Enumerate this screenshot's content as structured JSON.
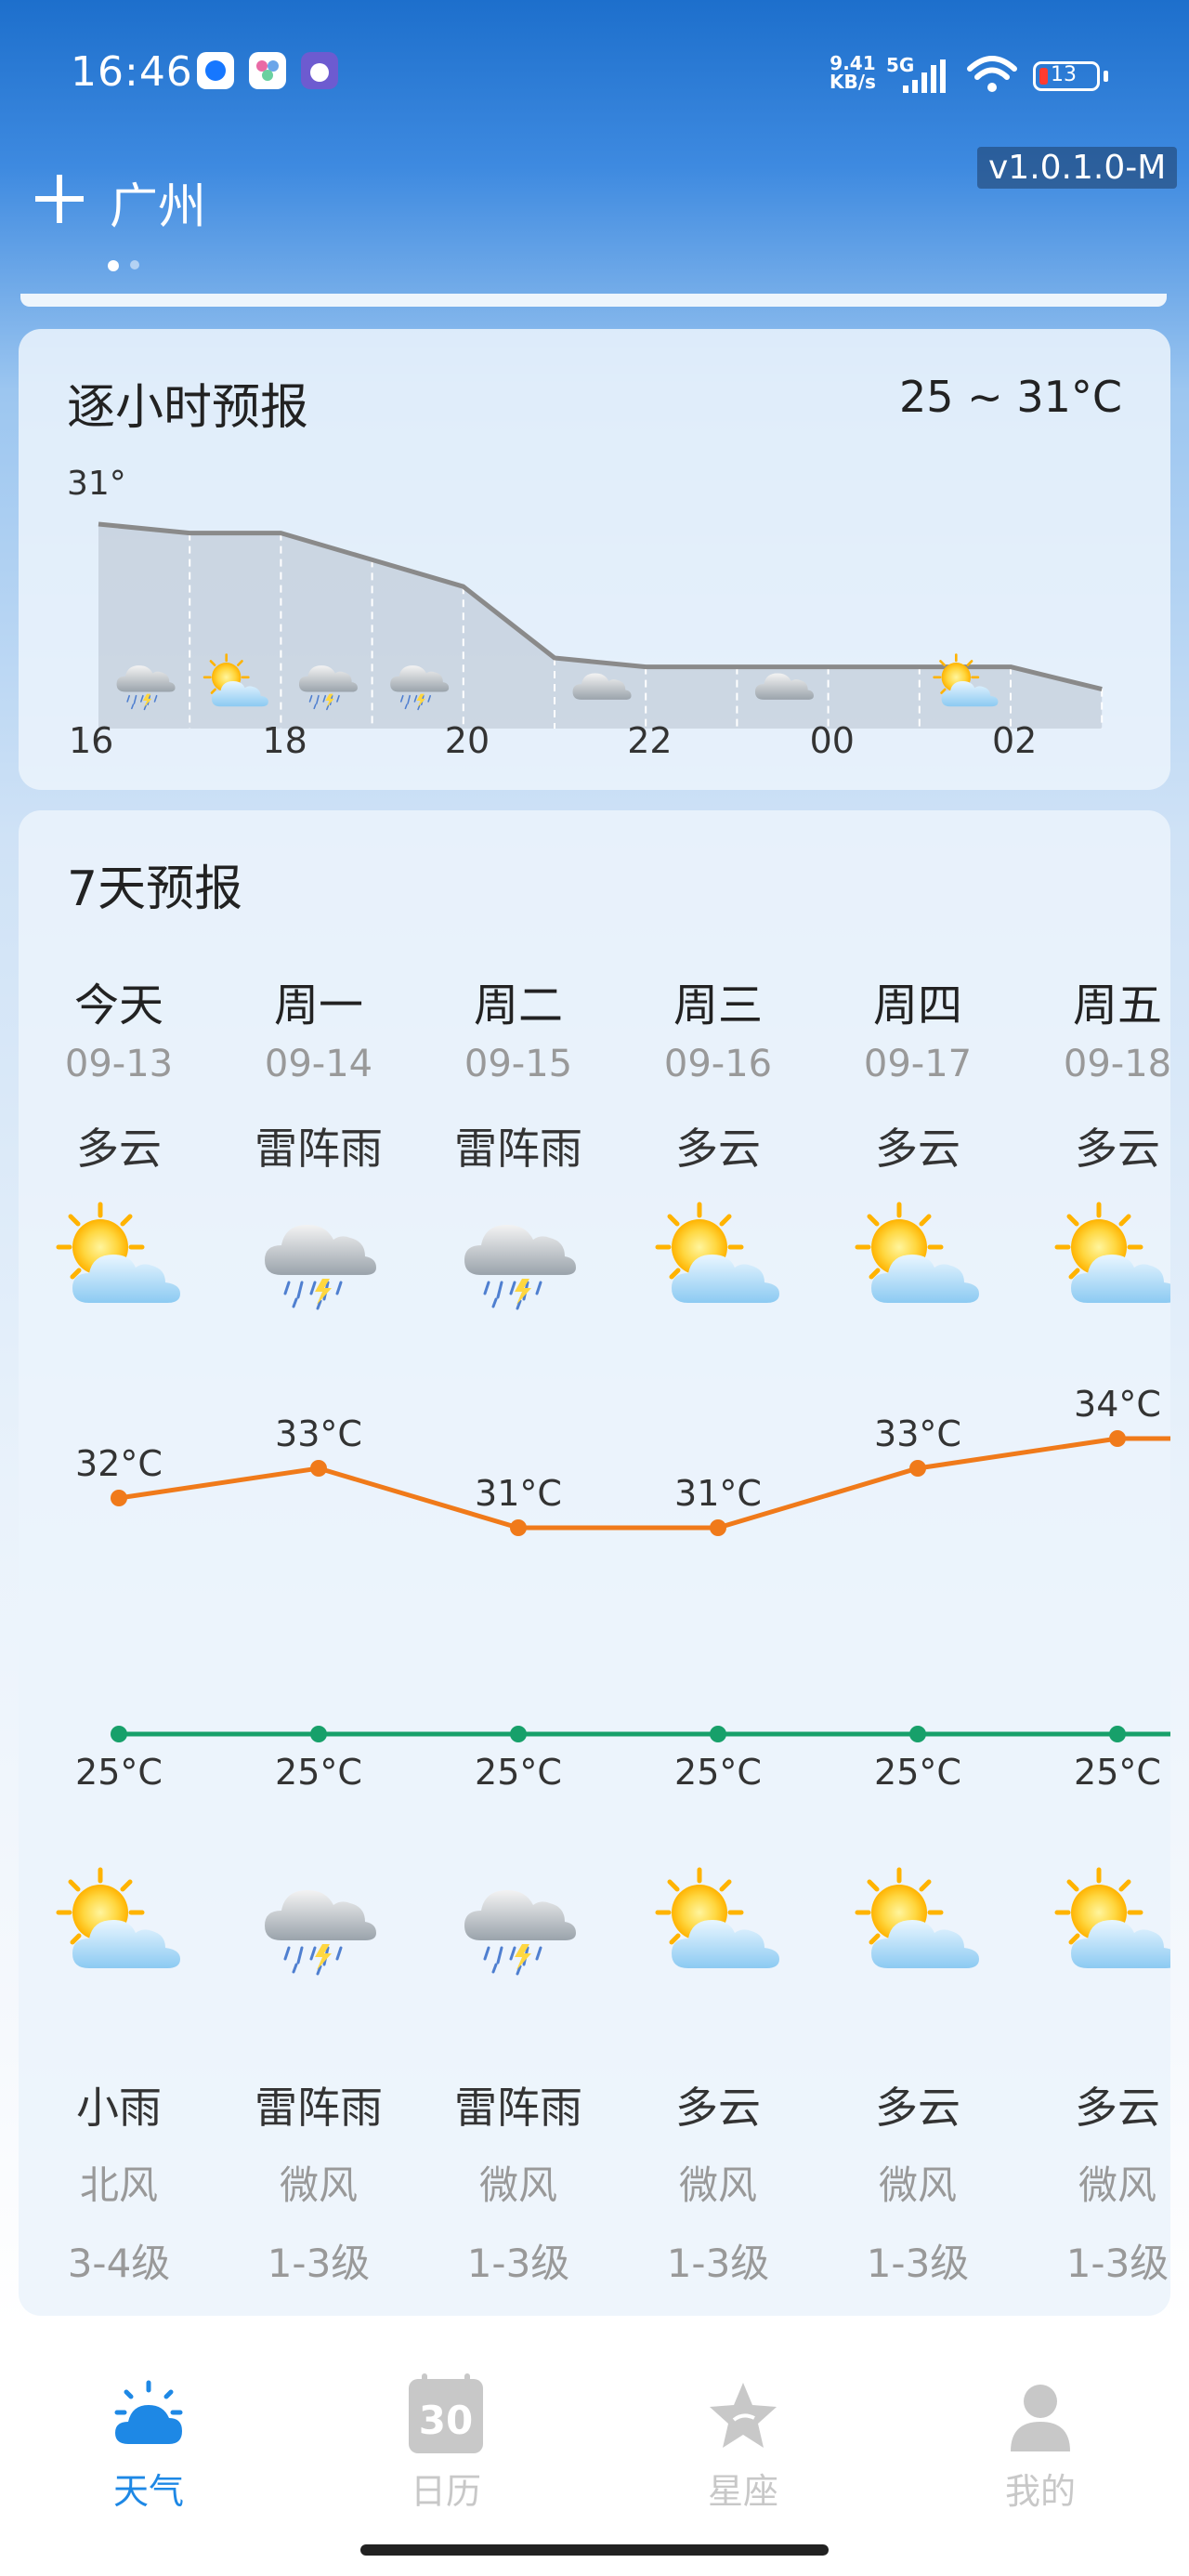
{
  "status_bar": {
    "time": "16:46",
    "net_speed_value": "9.41",
    "net_speed_unit": "KB/s",
    "net_type": "5G",
    "battery": "13"
  },
  "header": {
    "city": "广州",
    "version": "v1.0.1.0-M"
  },
  "hourly": {
    "title": "逐小时预报",
    "range": "25 ~ 31°C",
    "max_label": "31°",
    "time_labels": [
      "16",
      "18",
      "20",
      "22",
      "00",
      "02"
    ]
  },
  "weekly": {
    "title": "7天预报",
    "days": [
      {
        "weekday": "今天",
        "date": "09-13",
        "day_weather": "多云",
        "day_icon": "partly-cloudy-icon",
        "high": "32°C",
        "low": "25°C",
        "night_icon": "partly-cloudy-icon",
        "night_weather": "小雨",
        "wind": "北风",
        "level": "3-4级"
      },
      {
        "weekday": "周一",
        "date": "09-14",
        "day_weather": "雷阵雨",
        "day_icon": "thunderstorm-icon",
        "high": "33°C",
        "low": "25°C",
        "night_icon": "thunderstorm-icon",
        "night_weather": "雷阵雨",
        "wind": "微风",
        "level": "1-3级"
      },
      {
        "weekday": "周二",
        "date": "09-15",
        "day_weather": "雷阵雨",
        "day_icon": "thunderstorm-icon",
        "high": "31°C",
        "low": "25°C",
        "night_icon": "thunderstorm-icon",
        "night_weather": "雷阵雨",
        "wind": "微风",
        "level": "1-3级"
      },
      {
        "weekday": "周三",
        "date": "09-16",
        "day_weather": "多云",
        "day_icon": "partly-cloudy-icon",
        "high": "31°C",
        "low": "25°C",
        "night_icon": "partly-cloudy-icon",
        "night_weather": "多云",
        "wind": "微风",
        "level": "1-3级"
      },
      {
        "weekday": "周四",
        "date": "09-17",
        "day_weather": "多云",
        "day_icon": "partly-cloudy-icon",
        "high": "33°C",
        "low": "25°C",
        "night_icon": "partly-cloudy-icon",
        "night_weather": "多云",
        "wind": "微风",
        "level": "1-3级"
      },
      {
        "weekday": "周五",
        "date": "09-18",
        "day_weather": "多云",
        "day_icon": "partly-cloudy-icon",
        "high": "34°C",
        "low": "25°C",
        "night_icon": "partly-cloudy-icon",
        "night_weather": "多云",
        "wind": "微风",
        "level": "1-3级"
      }
    ]
  },
  "chart_data": [
    {
      "type": "line",
      "x": [
        "16",
        "17",
        "18",
        "19",
        "20",
        "21",
        "22",
        "23",
        "00",
        "01",
        "02",
        "03"
      ],
      "series": [
        {
          "values": [
            31,
            30.8,
            30.8,
            30.2,
            29.6,
            28,
            27.8,
            27.8,
            27.8,
            27.8,
            27.8,
            27.3
          ]
        }
      ]
    },
    {
      "type": "line",
      "categories": [
        "今天",
        "周一",
        "周二",
        "周三",
        "周四",
        "周五"
      ],
      "series": [
        {
          "values": [
            32,
            33,
            31,
            31,
            33,
            34
          ]
        },
        {
          "values": [
            25,
            25,
            25,
            25,
            25,
            25
          ]
        }
      ]
    }
  ],
  "bottom_nav": {
    "items": [
      {
        "label": "天气",
        "active": true
      },
      {
        "label": "日历",
        "active": false,
        "icon_text": "30"
      },
      {
        "label": "星座",
        "active": false
      },
      {
        "label": "我的",
        "active": false
      }
    ],
    "active_color": "#1e88e5",
    "inactive_color": "#c8c8c8"
  },
  "colors": {
    "high_line": "#f07a1a",
    "low_line": "#17a06a",
    "hourly_line": "#8a8a8a"
  }
}
